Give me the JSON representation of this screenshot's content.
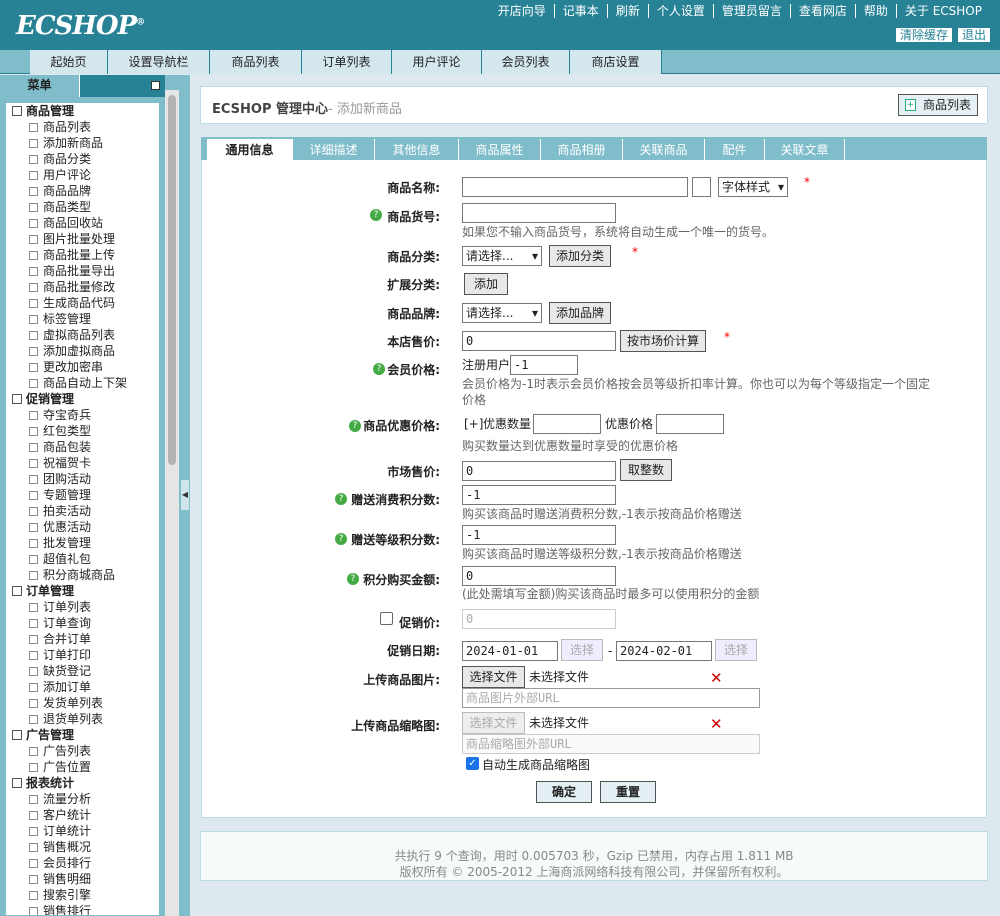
{
  "header": {
    "logo": "ECSHOP",
    "logo_mark": "®",
    "links": [
      "开店向导",
      "记事本",
      "刷新",
      "个人设置",
      "管理员留言",
      "查看网店",
      "帮助",
      "关于 ECSHOP"
    ],
    "clear_cache": "清除缓存",
    "logout": "退出"
  },
  "nav": [
    "起始页",
    "设置导航栏",
    "商品列表",
    "订单列表",
    "用户评论",
    "会员列表",
    "商店设置"
  ],
  "menu": {
    "title": "菜单",
    "groups": [
      {
        "label": "商品管理",
        "items": [
          "商品列表",
          "添加新商品",
          "商品分类",
          "用户评论",
          "商品品牌",
          "商品类型",
          "商品回收站",
          "图片批量处理",
          "商品批量上传",
          "商品批量导出",
          "商品批量修改",
          "生成商品代码",
          "标签管理",
          "虚拟商品列表",
          "添加虚拟商品",
          "更改加密串",
          "商品自动上下架"
        ]
      },
      {
        "label": "促销管理",
        "items": [
          "夺宝奇兵",
          "红包类型",
          "商品包装",
          "祝福贺卡",
          "团购活动",
          "专题管理",
          "拍卖活动",
          "优惠活动",
          "批发管理",
          "超值礼包",
          "积分商城商品"
        ]
      },
      {
        "label": "订单管理",
        "items": [
          "订单列表",
          "订单查询",
          "合并订单",
          "订单打印",
          "缺货登记",
          "添加订单",
          "发货单列表",
          "退货单列表"
        ]
      },
      {
        "label": "广告管理",
        "items": [
          "广告列表",
          "广告位置"
        ]
      },
      {
        "label": "报表统计",
        "items": [
          "流量分析",
          "客户统计",
          "订单统计",
          "销售概况",
          "会员排行",
          "销售明细",
          "搜索引擎",
          "销售排行"
        ]
      }
    ]
  },
  "page": {
    "title": "ECSHOP 管理中心",
    "subtitle": "- 添加新商品",
    "action": "商品列表"
  },
  "tabs": [
    "通用信息",
    "详细描述",
    "其他信息",
    "商品属性",
    "商品相册",
    "关联商品",
    "配件",
    "关联文章"
  ],
  "form": {
    "name_label": "商品名称:",
    "name_value": "",
    "font_style": "字体样式",
    "sn_label": "商品货号:",
    "sn_value": "",
    "sn_note": "如果您不输入商品货号，系统将自动生成一个唯一的货号。",
    "cat_label": "商品分类:",
    "cat_select": "请选择...",
    "add_cat": "添加分类",
    "ext_cat_label": "扩展分类:",
    "add": "添加",
    "brand_label": "商品品牌:",
    "brand_select": "请选择...",
    "add_brand": "添加品牌",
    "price_label": "本店售价:",
    "price_value": "0",
    "calc_market": "按市场价计算",
    "member_label": "会员价格:",
    "member_user": "注册用户",
    "member_value": "-1",
    "member_note": "会员价格为-1时表示会员价格按会员等级折扣率计算。你也可以为每个等级指定一个固定价格",
    "promo_label": "商品优惠价格:",
    "promo_plus": "[+]",
    "promo_qty": "优惠数量",
    "promo_qty_value": "",
    "promo_price": "优惠价格",
    "promo_price_value": "",
    "promo_note": "购买数量达到优惠数量时享受的优惠价格",
    "market_label": "市场售价:",
    "market_value": "0",
    "round": "取整数",
    "give_label": "赠送消费积分数:",
    "give_value": "-1",
    "give_note": "购买该商品时赠送消费积分数,-1表示按商品价格赠送",
    "rank_label": "赠送等级积分数:",
    "rank_value": "-1",
    "rank_note": "购买该商品时赠送等级积分数,-1表示按商品价格赠送",
    "integral_label": "积分购买金额:",
    "integral_value": "0",
    "integral_note": "(此处需填写金额)购买该商品时最多可以使用积分的金额",
    "promote_label": "促销价:",
    "promote_value": "0",
    "date_label": "促销日期:",
    "date_start": "2024-01-01",
    "date_end": "2024-02-01",
    "date_sep": "-",
    "choose": "选择",
    "img_label": "上传商品图片:",
    "choose_file": "选择文件",
    "no_file": "未选择文件",
    "img_url_placeholder": "商品图片外部URL",
    "thumb_label": "上传商品缩略图:",
    "thumb_url_placeholder": "商品缩略图外部URL",
    "auto_thumb": "自动生成商品缩略图",
    "ok": "确定",
    "reset": "重置",
    "delete_mark": "✕",
    "required": "*"
  },
  "footer": {
    "line1": "共执行 9 个查询，用时 0.005703 秒，Gzip 已禁用，内存占用 1.811 MB",
    "line2": "版权所有 © 2005-2012 上海商派网络科技有限公司，并保留所有权利。"
  }
}
